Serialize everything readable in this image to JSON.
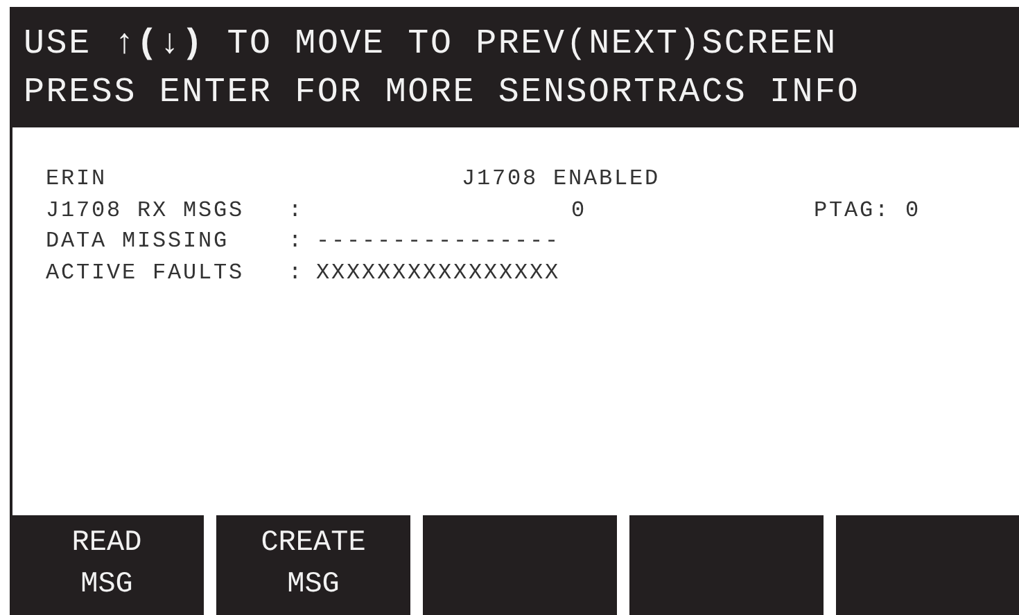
{
  "header": {
    "lines": [
      "USE **↑(↓)** TO MOVE TO PREV(NEXT)SCREEN",
      "PRESS ENTER FOR MORE SENSORTRACS INFO"
    ]
  },
  "status": {
    "name": "ERIN",
    "mode": "J1708 ENABLED"
  },
  "rows": [
    {
      "kind": "count",
      "label": "J1708 RX MSGS",
      "separator": ":",
      "value": "0",
      "extra": "PTAG: 0"
    },
    {
      "kind": "text",
      "label": "DATA MISSING",
      "separator": ":",
      "value": "----------------"
    },
    {
      "kind": "text",
      "label": "ACTIVE FAULTS",
      "separator": ":",
      "value": "XXXXXXXXXXXXXXXX"
    }
  ],
  "softkeys": [
    {
      "kind": "labeled",
      "lines": [
        "READ",
        "MSG"
      ]
    },
    {
      "kind": "labeled",
      "lines": [
        "CREATE",
        "MSG"
      ]
    },
    {
      "kind": "blank"
    },
    {
      "kind": "blank"
    },
    {
      "kind": "blank"
    }
  ]
}
